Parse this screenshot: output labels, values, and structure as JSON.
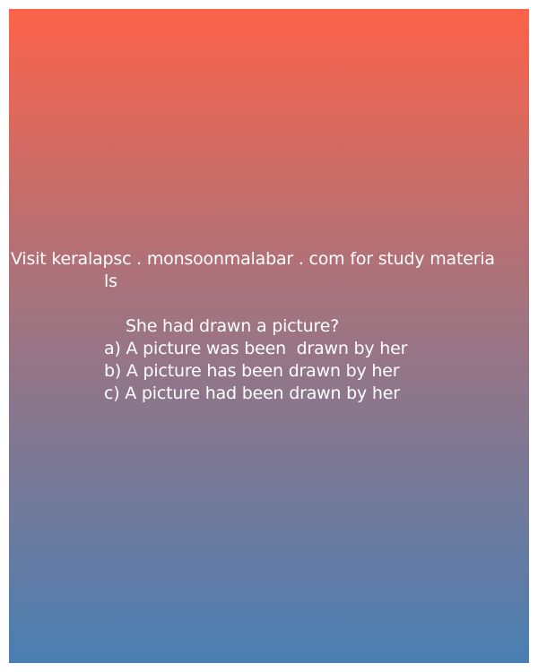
{
  "card": {
    "gradient_top": "#fd634a",
    "gradient_bottom": "#4a7fb2",
    "text_color": "#ffffff"
  },
  "content": {
    "promo_line_1": "Visit keralapsc . monsoonmalabar . com for study materia",
    "promo_line_2": "ls",
    "question": "She had drawn a picture?",
    "option_a": "a) A picture was been  drawn by her",
    "option_b": "b) A picture has been drawn by her",
    "option_c": "c) A picture had been drawn by her"
  }
}
